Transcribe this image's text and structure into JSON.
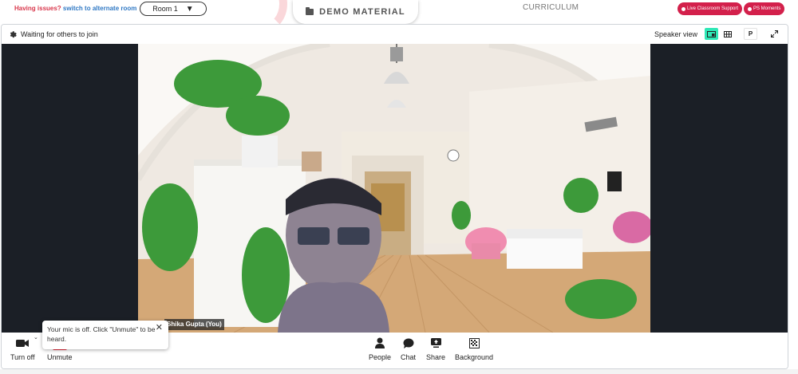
{
  "topbar": {
    "issue_question": "Having issues?",
    "issue_link": "switch to alternate room",
    "room_select": {
      "value": "Room 1",
      "caret": "▼"
    },
    "demo_material": "DEMO MATERIAL",
    "curriculum": "CURRICULUM",
    "live_support": "Live Classroom Support",
    "ps_moments": "PS Moments"
  },
  "meeting": {
    "status_text": "Waiting for others to join",
    "speaker_view_label": "Speaker view",
    "view_toggle_p": "P",
    "participant_name": "Shika Gupta (You)",
    "toast": {
      "message": "Your mic is off. Click \"Unmute\" to be heard.",
      "close": "✕"
    }
  },
  "controls": {
    "turn_off": "Turn off",
    "unmute": "Unmute",
    "people": "People",
    "chat": "Chat",
    "share": "Share",
    "background": "Background"
  },
  "colors": {
    "accent_red": "#d3204b",
    "link_blue": "#2f78c4",
    "speaker_active": "#2ee8b6",
    "mute_red": "#e8283a"
  }
}
